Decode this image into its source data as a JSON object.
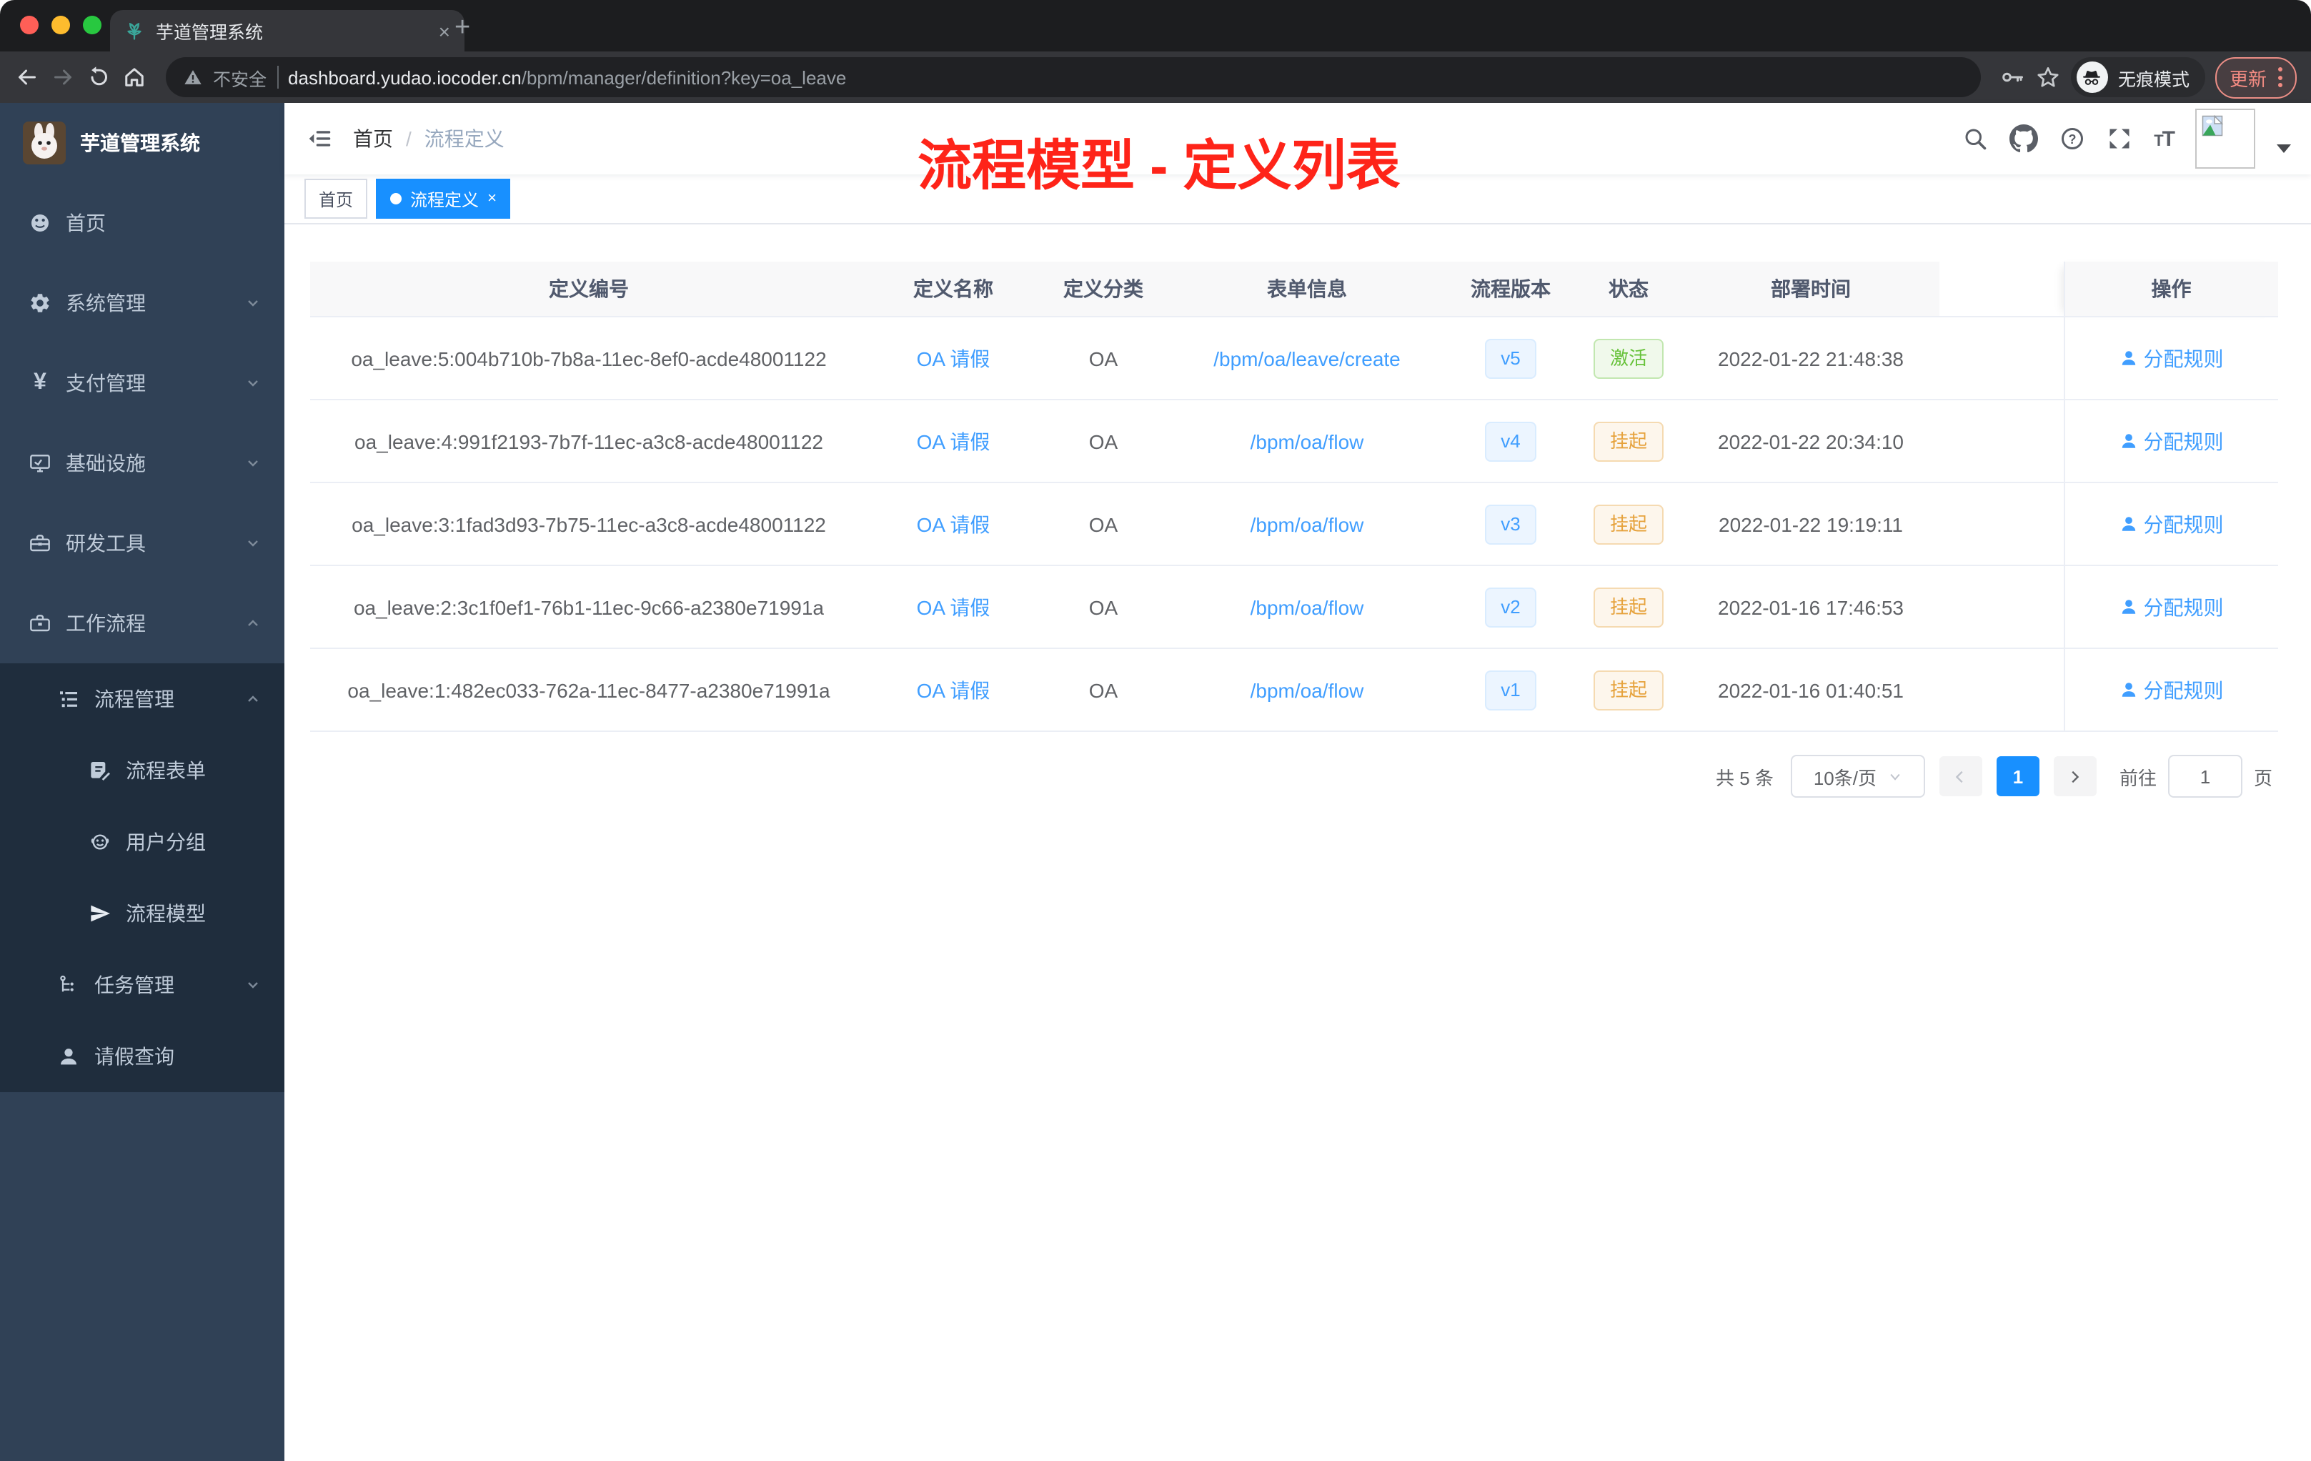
{
  "browser": {
    "tab_title": "芋道管理系统",
    "tab_close": "×",
    "new_tab": "+",
    "security_label": "不安全",
    "url_host": "dashboard.yudao.iocoder.cn",
    "url_path": "/bpm/manager/definition?key=oa_leave",
    "incognito_label": "无痕模式",
    "update_label": "更新",
    "traffic_colors": {
      "close": "#ff5f57",
      "minimize": "#febc2e",
      "zoom": "#28c840"
    }
  },
  "sidebar": {
    "logo_title": "芋道管理系统",
    "items": [
      {
        "label": "首页"
      },
      {
        "label": "系统管理"
      },
      {
        "label": "支付管理"
      },
      {
        "label": "基础设施"
      },
      {
        "label": "研发工具"
      },
      {
        "label": "工作流程"
      },
      {
        "label": "流程管理"
      },
      {
        "label": "流程表单"
      },
      {
        "label": "用户分组"
      },
      {
        "label": "流程模型"
      },
      {
        "label": "任务管理"
      },
      {
        "label": "请假查询"
      }
    ]
  },
  "navbar": {
    "breadcrumb_home": "首页",
    "breadcrumb_sep": "/",
    "breadcrumb_current": "流程定义"
  },
  "tags": {
    "home": "首页",
    "active": "流程定义",
    "close": "×"
  },
  "annotation": {
    "title": "流程模型 - 定义列表",
    "color": "#fe2419"
  },
  "table": {
    "headers": [
      "定义编号",
      "定义名称",
      "定义分类",
      "表单信息",
      "流程版本",
      "状态",
      "部署时间",
      "操作"
    ],
    "action_label": "分配规则",
    "rows": [
      {
        "id": "oa_leave:5:004b710b-7b8a-11ec-8ef0-acde48001122",
        "name": "OA 请假",
        "category": "OA",
        "form": "/bpm/oa/leave/create",
        "version": "v5",
        "status": "激活",
        "status_type": "success",
        "time": "2022-01-22 21:48:38",
        "action": "分配规则"
      },
      {
        "id": "oa_leave:4:991f2193-7b7f-11ec-a3c8-acde48001122",
        "name": "OA 请假",
        "category": "OA",
        "form": "/bpm/oa/flow",
        "version": "v4",
        "status": "挂起",
        "status_type": "warning",
        "time": "2022-01-22 20:34:10",
        "action": "分配规则"
      },
      {
        "id": "oa_leave:3:1fad3d93-7b75-11ec-a3c8-acde48001122",
        "name": "OA 请假",
        "category": "OA",
        "form": "/bpm/oa/flow",
        "version": "v3",
        "status": "挂起",
        "status_type": "warning",
        "time": "2022-01-22 19:19:11",
        "action": "分配规则"
      },
      {
        "id": "oa_leave:2:3c1f0ef1-76b1-11ec-9c66-a2380e71991a",
        "name": "OA 请假",
        "category": "OA",
        "form": "/bpm/oa/flow",
        "version": "v2",
        "status": "挂起",
        "status_type": "warning",
        "time": "2022-01-16 17:46:53",
        "action": "分配规则"
      },
      {
        "id": "oa_leave:1:482ec033-762a-11ec-8477-a2380e71991a",
        "name": "OA 请假",
        "category": "OA",
        "form": "/bpm/oa/flow",
        "version": "v1",
        "status": "挂起",
        "status_type": "warning",
        "time": "2022-01-16 01:40:51",
        "action": "分配规则"
      }
    ]
  },
  "pagination": {
    "total": "共 5 条",
    "page_size": "10条/页",
    "current_page": "1",
    "goto_label": "前往",
    "goto_value": "1",
    "page_unit": "页"
  },
  "colors": {
    "accent_blue": "#409eff",
    "active_tag_blue": "#1890ff",
    "sidebar_bg": "#304156",
    "submenu_bg": "#1f2d3d",
    "success_green": "#67c23a",
    "warning_orange": "#e6a23c"
  }
}
